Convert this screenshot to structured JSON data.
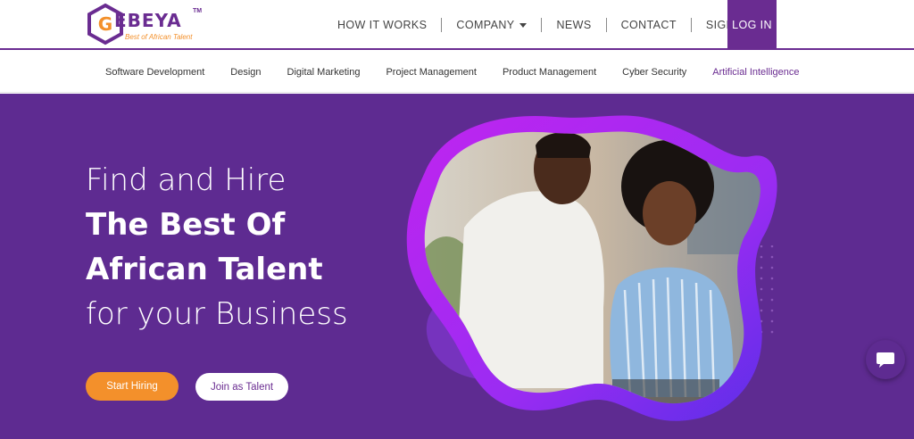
{
  "brand": {
    "logo_letter": "G",
    "logo_word": "EBEYA",
    "trademark": "TM",
    "tagline": "Best of African Talent",
    "primary_color": "#6a2c91",
    "accent_color": "#f3902b"
  },
  "nav": {
    "items": [
      {
        "label": "HOW IT WORKS"
      },
      {
        "label": "COMPANY",
        "icon": "chevron-down-icon"
      },
      {
        "label": "NEWS"
      },
      {
        "label": "CONTACT"
      },
      {
        "label": "SIGN UP"
      }
    ],
    "login_label": "LOG IN"
  },
  "categories": {
    "items": [
      "Software Development",
      "Design",
      "Digital Marketing",
      "Project Management",
      "Product Management",
      "Cyber Security",
      "Artificial Intelligence"
    ],
    "active": "Artificial Intelligence"
  },
  "hero": {
    "line1": "Find and Hire",
    "line2": "The Best Of",
    "line3": "African Talent",
    "line4": "for your Business",
    "primary_button": "Start Hiring",
    "secondary_button": "Join as Talent",
    "background_color": "#5e2b91"
  },
  "chat": {
    "icon": "chat-bubble-icon"
  }
}
